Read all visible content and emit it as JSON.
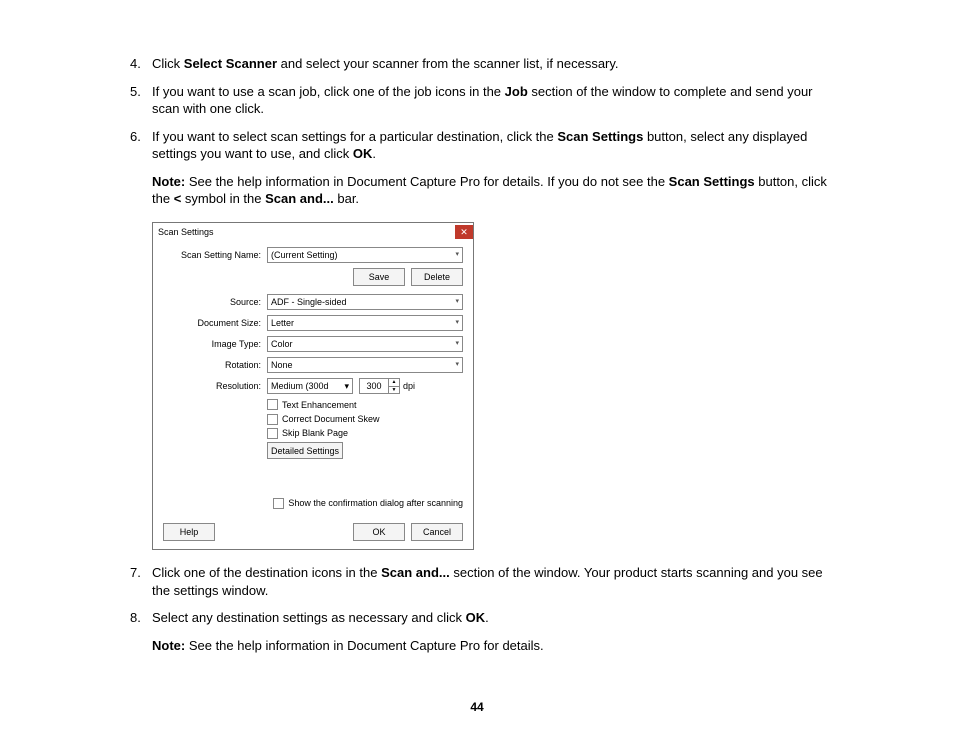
{
  "steps": {
    "s4": {
      "num": "4.",
      "pre": "Click ",
      "b1": "Select Scanner",
      "post": " and select your scanner from the scanner list, if necessary."
    },
    "s5": {
      "num": "5.",
      "pre": "If you want to use a scan job, click one of the job icons in the ",
      "b1": "Job",
      "post": " section of the window to complete and send your scan with one click."
    },
    "s6": {
      "num": "6.",
      "pre": "If you want to select scan settings for a particular destination, click the ",
      "b1": "Scan Settings",
      "mid": " button, select any displayed settings you want to use, and click ",
      "b2": "OK",
      "end": "."
    },
    "s6_note": {
      "b0": "Note:",
      "p1": " See the help information in Document Capture Pro for details. If you do not see the ",
      "b1": "Scan Settings",
      "p2": " button, click the ",
      "b2": "<",
      "p3": " symbol in the ",
      "b3": "Scan and...",
      "p4": " bar."
    },
    "s7": {
      "num": "7.",
      "pre": "Click one of the destination icons in the ",
      "b1": "Scan and...",
      "post": " section of the window. Your product starts scanning and you see the settings window."
    },
    "s8": {
      "num": "8.",
      "pre": "Select any destination settings as necessary and click ",
      "b1": "OK",
      "end": "."
    },
    "s8_note": {
      "b0": "Note:",
      "p1": " See the help information in Document Capture Pro for details."
    }
  },
  "dialog": {
    "title": "Scan Settings",
    "name_label": "Scan Setting Name:",
    "name_value": "(Current Setting)",
    "save": "Save",
    "delete": "Delete",
    "source_label": "Source:",
    "source_value": "ADF - Single-sided",
    "docsize_label": "Document Size:",
    "docsize_value": "Letter",
    "imgtype_label": "Image Type:",
    "imgtype_value": "Color",
    "rotation_label": "Rotation:",
    "rotation_value": "None",
    "res_label": "Resolution:",
    "res_value": "Medium (300d",
    "res_num": "300",
    "res_unit": "dpi",
    "chk1": "Text Enhancement",
    "chk2": "Correct Document Skew",
    "chk3": "Skip Blank Page",
    "detailed": "Detailed Settings",
    "confirm": "Show the confirmation dialog after scanning",
    "help": "Help",
    "ok": "OK",
    "cancel": "Cancel"
  },
  "page_num": "44"
}
